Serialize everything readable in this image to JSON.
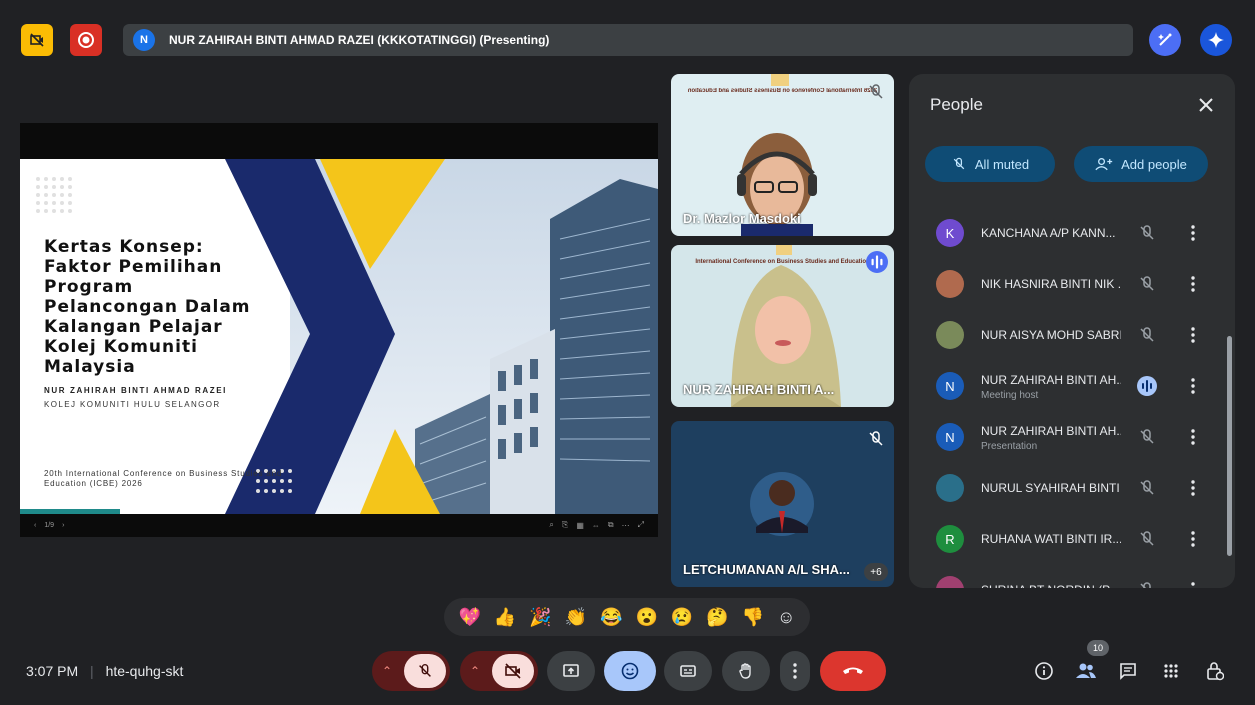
{
  "topbar": {
    "presenter_initial": "N",
    "presenting_text": "NUR ZAHIRAH BINTI AHMAD RAZEI (KKKOTATINGGI) (Presenting)"
  },
  "slide": {
    "title_lines": [
      "Kertas Konsep:",
      "Faktor Pemilihan",
      "Program",
      "Pelancongan Dalam",
      "Kalangan Pelajar",
      "Kolej Komuniti",
      "Malaysia"
    ],
    "author": "NUR ZAHIRAH BINTI AHMAD RAZEI",
    "institution": "KOLEJ KOMUNITI HULU SELANGOR",
    "conference": "20th International Conference on Business Studies and Education (ICBE) 2026",
    "page_indicator": "1/9",
    "colors": {
      "navy": "#1a2a6c",
      "gold": "#f4c51a"
    }
  },
  "tiles": [
    {
      "name": "Dr. Mazlor Masdoki",
      "banner": "2026 International Conference on Business Studies and Education"
    },
    {
      "name": "NUR ZAHIRAH BINTI A...",
      "banner": "International Conference on Business Studies and Education"
    },
    {
      "name": "LETCHUMANAN A/L SHA...",
      "extra": "+6"
    }
  ],
  "people": {
    "title": "People",
    "all_muted": "All muted",
    "add_people": "Add people",
    "list": [
      {
        "initial": "K",
        "name": "KANCHANA A/P KANN...",
        "sub": "",
        "color": "#6f4bcf",
        "status": "muted"
      },
      {
        "initial": "",
        "name": "NIK HASNIRA BINTI NIK ...",
        "sub": "",
        "color": "#b06a4e",
        "status": "muted"
      },
      {
        "initial": "",
        "name": "NUR AISYA MOHD SABRI",
        "sub": "",
        "color": "#7a8a5a",
        "status": "muted"
      },
      {
        "initial": "N",
        "name": "NUR ZAHIRAH BINTI AH...",
        "sub": "Meeting host",
        "color": "#1a5cb8",
        "status": "speaking"
      },
      {
        "initial": "N",
        "name": "NUR ZAHIRAH BINTI AH...",
        "sub": "Presentation",
        "color": "#1a5cb8",
        "status": "muted"
      },
      {
        "initial": "",
        "name": "NURUL SYAHIRAH BINTI ...",
        "sub": "",
        "color": "#2a6f8a",
        "status": "muted"
      },
      {
        "initial": "R",
        "name": "RUHANA WATI BINTI IR...",
        "sub": "",
        "color": "#1e8e3e",
        "status": "muted"
      },
      {
        "initial": "",
        "name": "SURINA BT NORDIN (P...",
        "sub": "",
        "color": "#a04070",
        "status": "muted"
      }
    ]
  },
  "reactions": [
    "💖",
    "👍",
    "🎉",
    "👏",
    "😂",
    "😮",
    "😢",
    "🤔",
    "👎",
    "☺"
  ],
  "bottom": {
    "time": "3:07 PM",
    "separator": "|",
    "meeting_code": "hte-quhg-skt",
    "participant_count": "10"
  }
}
